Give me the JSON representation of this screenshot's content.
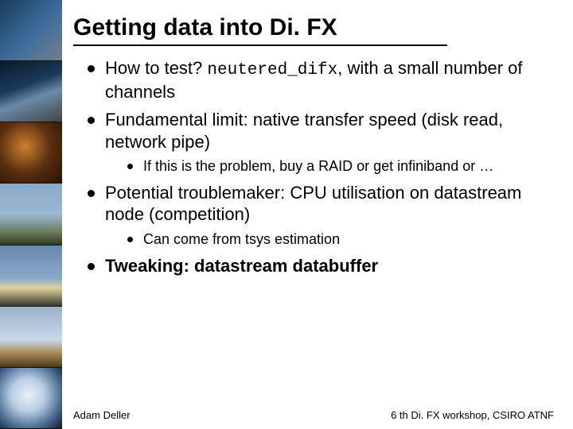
{
  "title": "Getting data into Di. FX",
  "bullets": [
    {
      "text_prefix": "How to test? ",
      "code": "neutered_difx",
      "text_suffix": ", with a small number of channels"
    },
    {
      "text": "Fundamental limit: native transfer speed (disk read, network pipe)",
      "sub": [
        "If this is the problem, buy a RAID or get infiniband or …"
      ]
    },
    {
      "text": "Potential troublemaker: CPU utilisation on datastream node (competition)",
      "sub": [
        "Can come from tsys estimation"
      ]
    },
    {
      "bold_text": "Tweaking: datastream databuffer"
    }
  ],
  "footer": {
    "left": "Adam Deller",
    "right": "6 th Di. FX workshop, CSIRO ATNF"
  }
}
